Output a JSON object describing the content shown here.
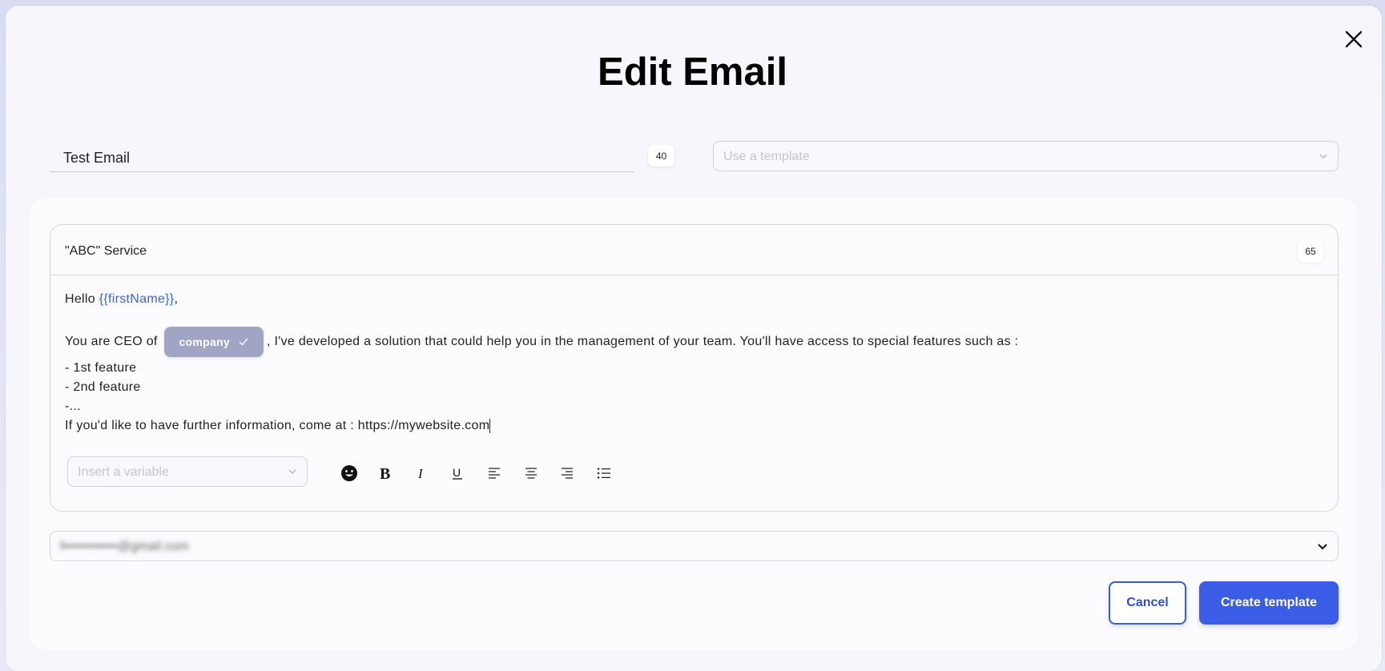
{
  "modal": {
    "title": "Edit Email",
    "close_icon": "close-icon"
  },
  "email_name": {
    "value": "Test Email",
    "char_count": "40"
  },
  "template_select": {
    "placeholder": "Use a template",
    "icon": "chevron-down-icon"
  },
  "editor": {
    "subject": "\"ABC\" Service",
    "subject_count": "65",
    "greeting_prefix": "Hello ",
    "greeting_variable": "{{firstName}}",
    "greeting_suffix": ",",
    "line2_prefix": "You are CEO of",
    "chip_label": "company",
    "chip_icon": "check-icon",
    "line2_suffix": ", I've developed a solution that could help you in the management of your team. You'll have  access to special features such as :",
    "bullet1": "- 1st feature",
    "bullet2": "- 2nd feature",
    "bullet3": "-...",
    "closing": "If you'd like to have further information, come at : https://mywebsite.com",
    "variable_select_placeholder": "Insert a variable",
    "toolbar": [
      "emoji-icon",
      "bold-icon",
      "italic-icon",
      "underline-icon",
      "align-left-icon",
      "align-center-icon",
      "align-right-icon",
      "list-icon"
    ]
  },
  "sender": {
    "value": "f••••••••••••@gmail.com",
    "icon": "chevron-down-icon"
  },
  "actions": {
    "cancel_label": "Cancel",
    "create_label": "Create template"
  },
  "colors": {
    "primary": "#3a5ce6",
    "variable_text": "#3d63d6",
    "chip_bg": "#a1a4c4"
  }
}
